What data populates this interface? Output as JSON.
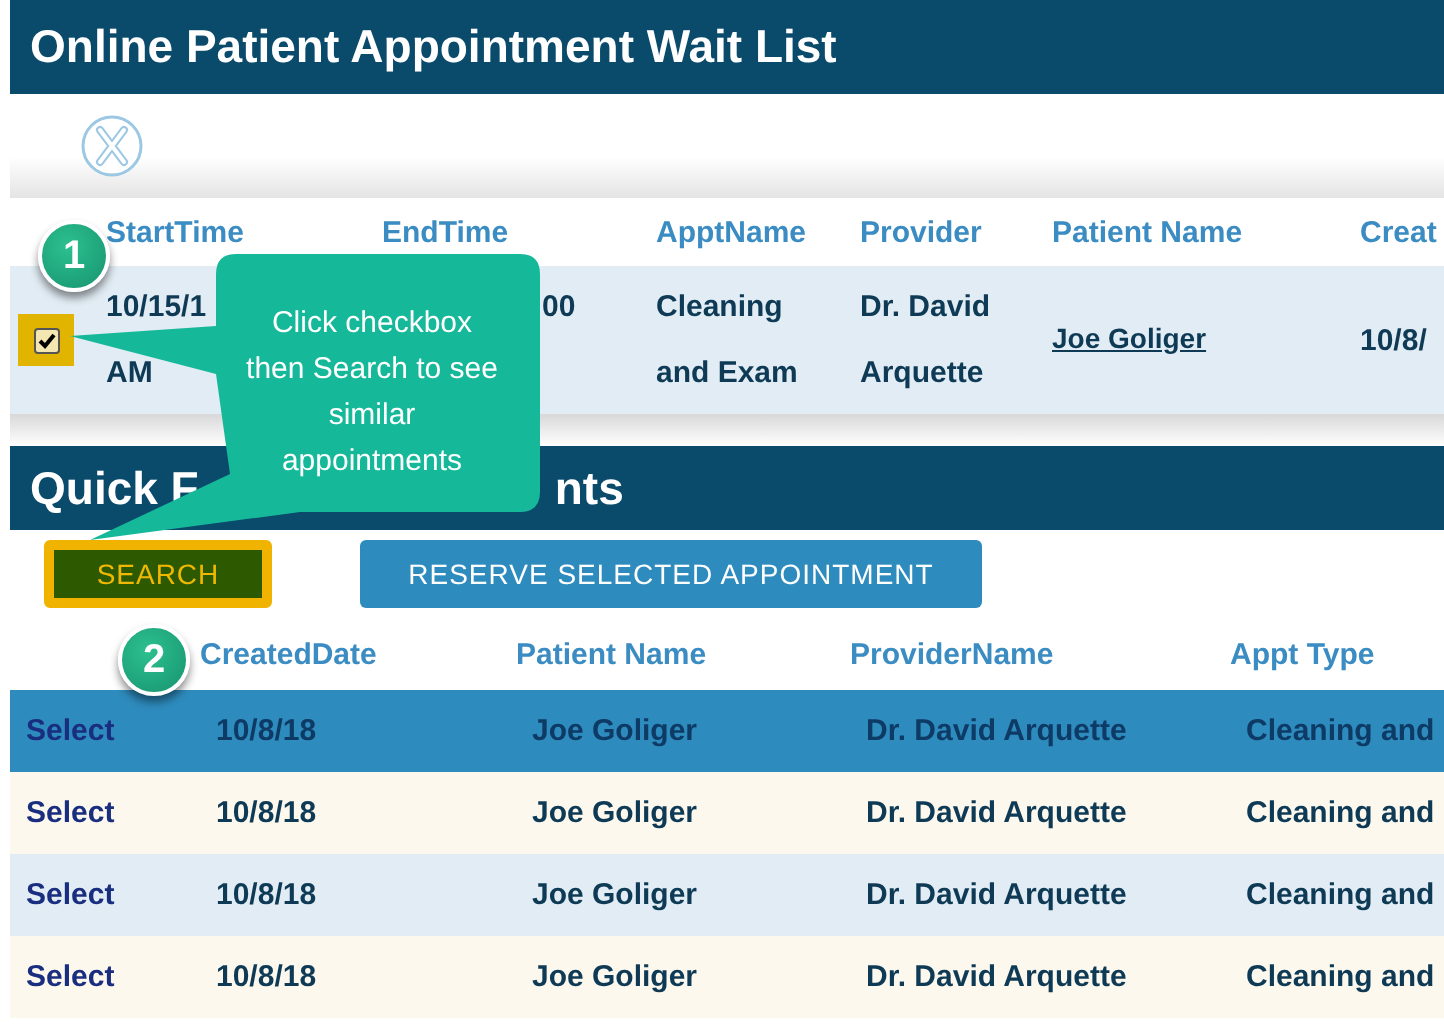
{
  "page_title": "Online Patient Appointment Wait List",
  "wait_list": {
    "columns": [
      "StartTime",
      "EndTime",
      "ApptName",
      "Provider",
      "Patient Name",
      "Creat"
    ],
    "rows": [
      {
        "checked": true,
        "start_time": [
          "10/15/1",
          "AM"
        ],
        "end_time": "00",
        "appt_name": [
          "Cleaning",
          "and Exam"
        ],
        "provider": [
          "Dr. David",
          "Arquette"
        ],
        "patient_name": "Joe Goliger",
        "created": "10/8/"
      }
    ]
  },
  "section_title": [
    "Quick F",
    "nts"
  ],
  "buttons": [
    {
      "kind": "search",
      "label": "SEARCH",
      "highlighted": true
    },
    {
      "kind": "reserve",
      "label": "RESERVE SELECTED APPOINTMENT",
      "highlighted": false
    }
  ],
  "results": {
    "columns": [
      "",
      "CreatedDate",
      "Patient Name",
      "ProviderName",
      "Appt Type"
    ],
    "rows": [
      {
        "selected": true,
        "action": "Select",
        "created": "10/8/18",
        "patient": "Joe Goliger",
        "provider": "Dr. David Arquette",
        "appt_type": "Cleaning and"
      },
      {
        "selected": false,
        "action": "Select",
        "created": "10/8/18",
        "patient": "Joe Goliger",
        "provider": "Dr. David Arquette",
        "appt_type": "Cleaning and"
      },
      {
        "selected": false,
        "action": "Select",
        "created": "10/8/18",
        "patient": "Joe Goliger",
        "provider": "Dr. David Arquette",
        "appt_type": "Cleaning and"
      },
      {
        "selected": false,
        "action": "Select",
        "created": "10/8/18",
        "patient": "Joe Goliger",
        "provider": "Dr. David Arquette",
        "appt_type": "Cleaning and"
      }
    ]
  },
  "callout": {
    "text": "Click checkbox then Search to see similar appointments"
  },
  "steps": [
    "1",
    "2"
  ]
}
